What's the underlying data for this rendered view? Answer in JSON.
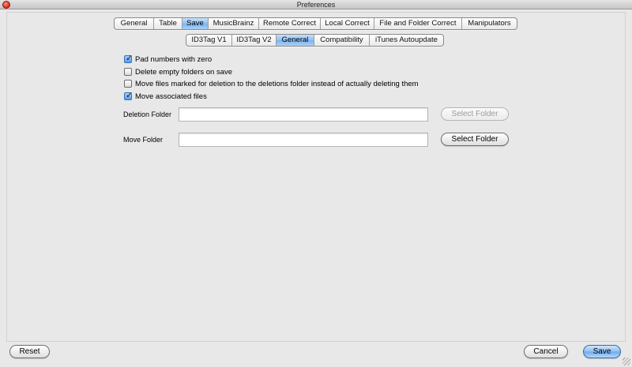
{
  "window": {
    "title": "Preferences"
  },
  "main_tabs": [
    {
      "label": "General",
      "selected": false
    },
    {
      "label": "Table",
      "selected": false
    },
    {
      "label": "Save",
      "selected": true
    },
    {
      "label": "MusicBrainz",
      "selected": false
    },
    {
      "label": "Remote Correct",
      "selected": false
    },
    {
      "label": "Local Correct",
      "selected": false
    },
    {
      "label": "File and Folder Correct",
      "selected": false
    },
    {
      "label": "Manipulators",
      "selected": false
    }
  ],
  "sub_tabs": [
    {
      "label": "ID3Tag V1",
      "selected": false
    },
    {
      "label": "ID3Tag V2",
      "selected": false
    },
    {
      "label": "General",
      "selected": true
    },
    {
      "label": "Compatibility",
      "selected": false
    },
    {
      "label": "iTunes Autoupdate",
      "selected": false
    }
  ],
  "options": [
    {
      "label": "Pad numbers with zero",
      "checked": true
    },
    {
      "label": "Delete empty folders on save",
      "checked": false
    },
    {
      "label": "Move files marked for deletion to the deletions folder instead of actually deleting them",
      "checked": false
    },
    {
      "label": "Move associated files",
      "checked": true
    }
  ],
  "deletion_folder": {
    "label": "Deletion Folder",
    "value": "",
    "button": "Select Folder",
    "enabled": false
  },
  "move_folder": {
    "label": "Move Folder",
    "value": "",
    "button": "Select Folder",
    "enabled": true
  },
  "footer": {
    "reset": "Reset",
    "cancel": "Cancel",
    "save": "Save"
  }
}
